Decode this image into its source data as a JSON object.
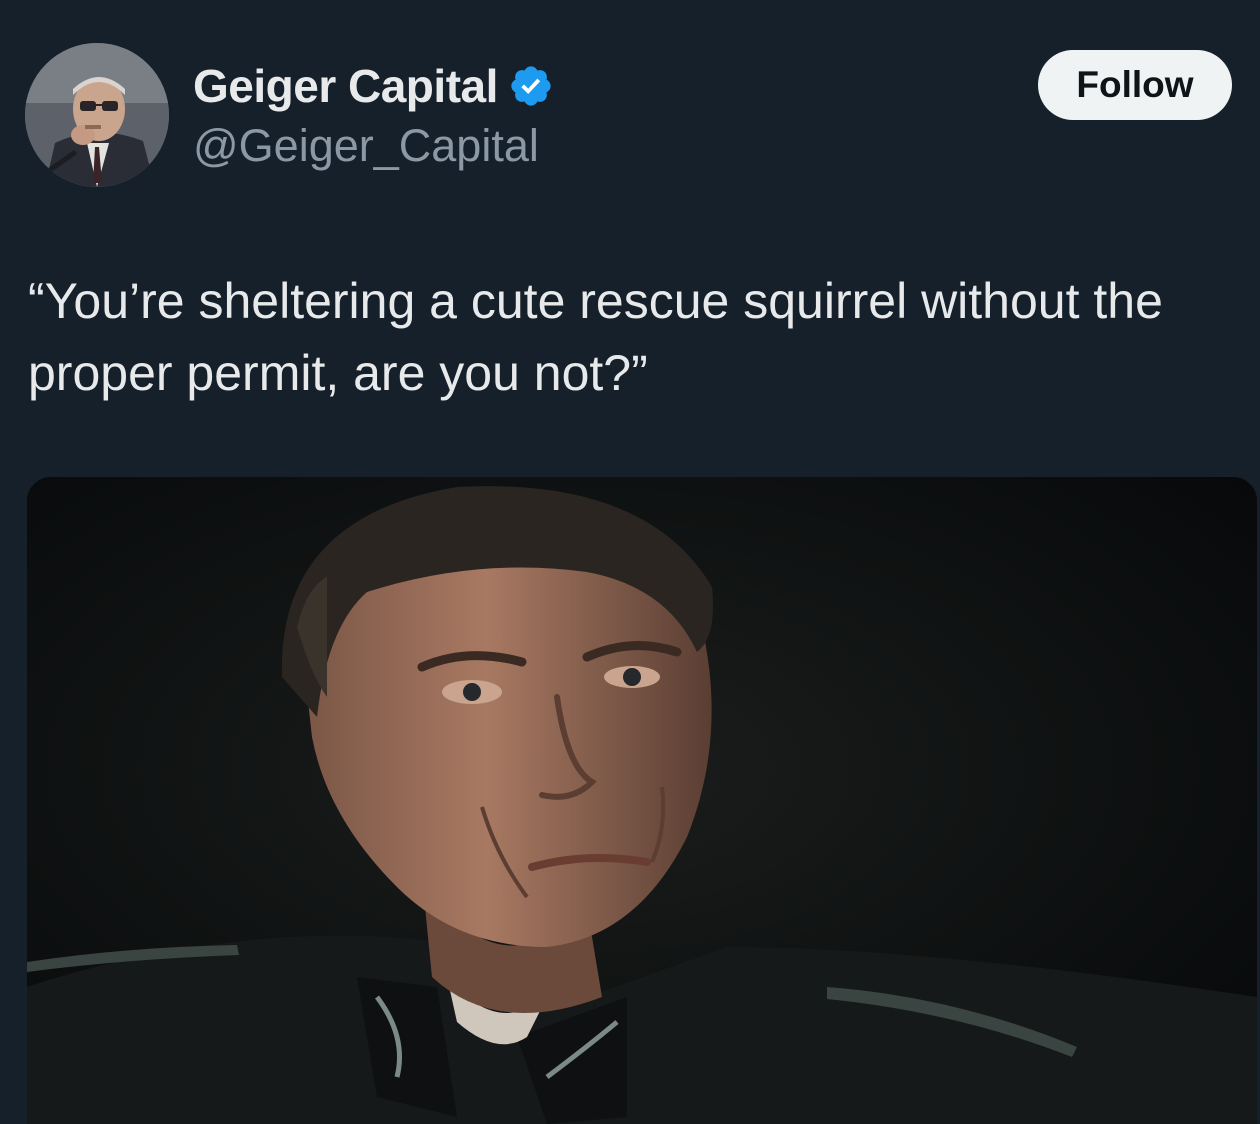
{
  "user": {
    "display_name": "Geiger Capital",
    "handle": "@Geiger_Capital",
    "verified": true,
    "avatar_icon": "profile-photo",
    "badge_color": "#1d9bf0"
  },
  "follow_button": {
    "label": "Follow"
  },
  "tweet": {
    "text": "“You’re sheltering a cute rescue squirrel without the proper permit, are you not?”"
  },
  "media": {
    "type": "photo",
    "icon": "photo-image"
  },
  "colors": {
    "background": "#15202b",
    "primary_text": "#e7e9ea",
    "secondary_text": "#8b98a5",
    "button_bg": "#eff3f4",
    "button_text": "#0f1419"
  }
}
